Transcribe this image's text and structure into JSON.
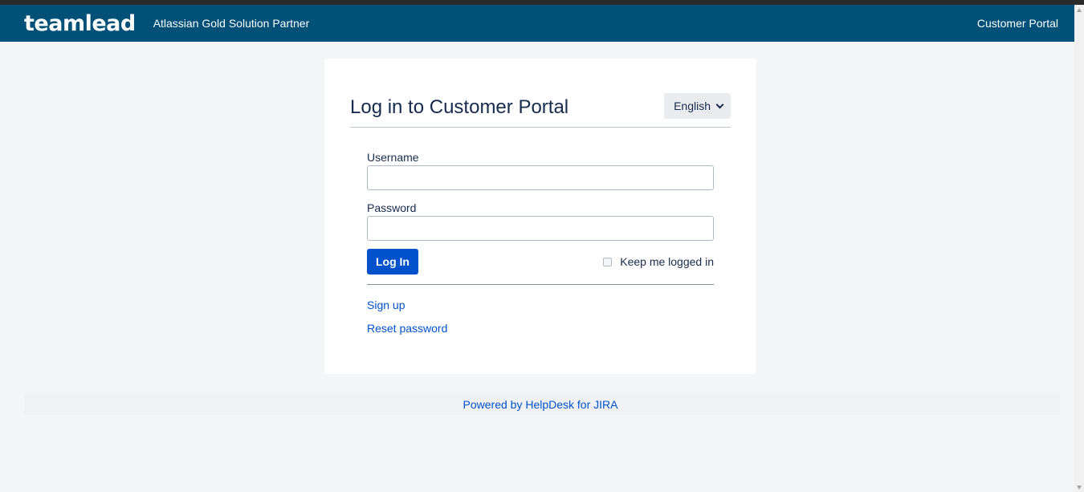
{
  "header": {
    "logo": "teamlead",
    "tagline": "Atlassian Gold Solution Partner",
    "portal_link": "Customer Portal"
  },
  "login": {
    "title": "Log in to Customer Portal",
    "language": "English",
    "username_label": "Username",
    "username_value": "",
    "password_label": "Password",
    "password_value": "",
    "login_button": "Log In",
    "remember_label": "Keep me logged in",
    "remember_checked": false,
    "signup_link": "Sign up",
    "reset_link": "Reset password"
  },
  "footer": {
    "powered_by": "Powered by HelpDesk for JIRA"
  },
  "colors": {
    "header_bg": "#005078",
    "page_bg": "#f4f5f7",
    "primary": "#0052cc",
    "text": "#172b4d"
  },
  "icons": {
    "language_dropdown": "chevron-down-icon",
    "remember": "checkbox"
  }
}
